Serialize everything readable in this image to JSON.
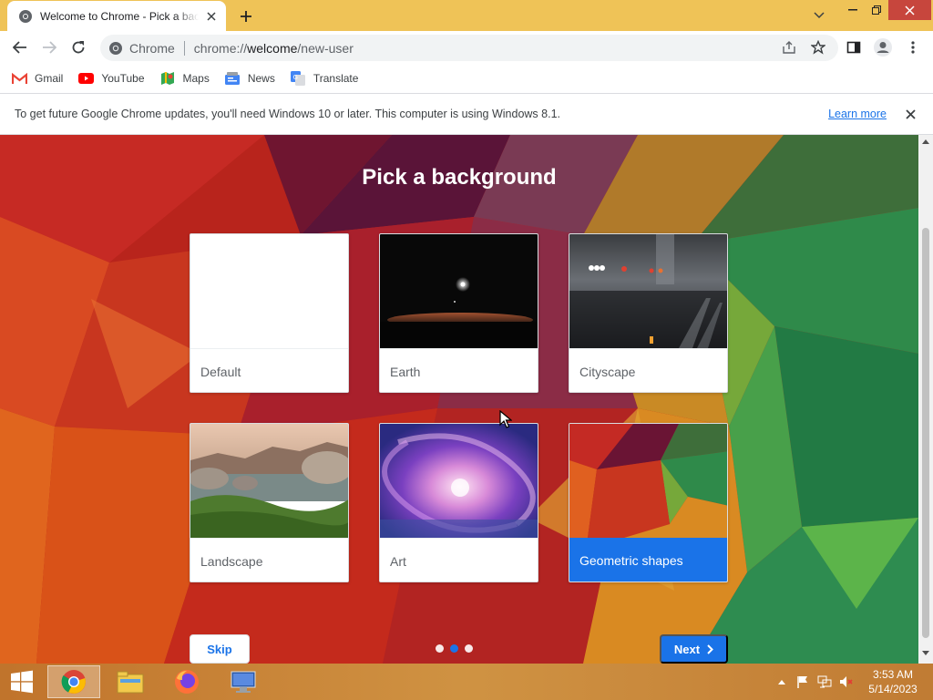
{
  "browser": {
    "tab_title": "Welcome to Chrome - Pick a background",
    "omnibox_chip": "Chrome",
    "url_host": "chrome://",
    "url_bold": "welcome",
    "url_path": "/new-user",
    "titlebar_color": "#efc357"
  },
  "bookmarks": [
    {
      "label": "Gmail",
      "icon": "gmail-icon"
    },
    {
      "label": "YouTube",
      "icon": "youtube-icon"
    },
    {
      "label": "Maps",
      "icon": "maps-icon"
    },
    {
      "label": "News",
      "icon": "news-icon"
    },
    {
      "label": "Translate",
      "icon": "translate-icon"
    }
  ],
  "infobar": {
    "message": "To get future Google Chrome updates, you'll need Windows 10 or later. This computer is using Windows 8.1.",
    "link": "Learn more"
  },
  "welcome": {
    "title": "Pick a background",
    "cards": [
      {
        "label": "Default",
        "selected": false
      },
      {
        "label": "Earth",
        "selected": false
      },
      {
        "label": "Cityscape",
        "selected": false
      },
      {
        "label": "Landscape",
        "selected": false
      },
      {
        "label": "Art",
        "selected": false
      },
      {
        "label": "Geometric shapes",
        "selected": true
      }
    ],
    "skip_label": "Skip",
    "next_label": "Next",
    "steps_total": 3,
    "step_current": 2,
    "accent_color": "#1a73e8"
  },
  "taskbar": {
    "apps": [
      "windows-start",
      "chrome",
      "file-explorer",
      "firefox",
      "remote-desktop"
    ],
    "time": "3:53 AM",
    "date": "5/14/2023"
  }
}
